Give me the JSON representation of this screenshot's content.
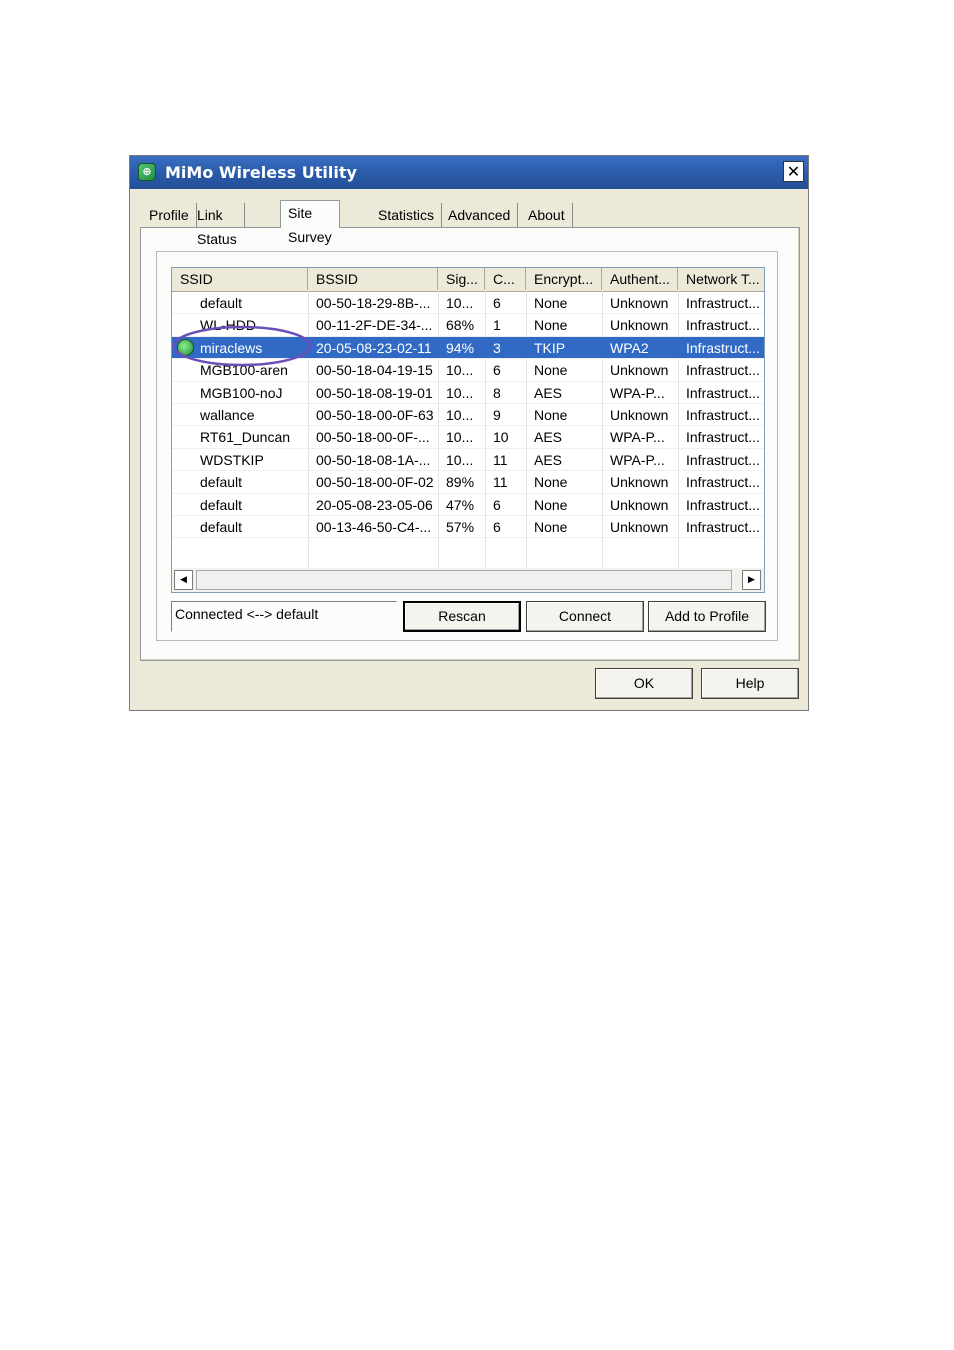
{
  "window": {
    "title": "MiMo Wireless Utility",
    "close_glyph": "✕"
  },
  "tabs": [
    {
      "label": "Profile"
    },
    {
      "label": "Link Status"
    },
    {
      "label": "Site Survey",
      "active": true
    },
    {
      "label": "Statistics"
    },
    {
      "label": "Advanced"
    },
    {
      "label": "About"
    }
  ],
  "table": {
    "columns": [
      "SSID",
      "BSSID",
      "Sig...",
      "C...",
      "Encrypt...",
      "Authent...",
      "Network T..."
    ],
    "rows": [
      {
        "ssid": "default",
        "bssid": "00-50-18-29-8B-...",
        "sig": "10...",
        "ch": "6",
        "enc": "None",
        "auth": "Unknown",
        "net": "Infrastruct..."
      },
      {
        "ssid": "WL-HDD",
        "bssid": "00-11-2F-DE-34-...",
        "sig": "68%",
        "ch": "1",
        "enc": "None",
        "auth": "Unknown",
        "net": "Infrastruct..."
      },
      {
        "ssid": "miraclews",
        "bssid": "20-05-08-23-02-11",
        "sig": "94%",
        "ch": "3",
        "enc": "TKIP",
        "auth": "WPA2",
        "net": "Infrastruct...",
        "selected": true
      },
      {
        "ssid": "MGB100-aren",
        "bssid": "00-50-18-04-19-15",
        "sig": "10...",
        "ch": "6",
        "enc": "None",
        "auth": "Unknown",
        "net": "Infrastruct..."
      },
      {
        "ssid": "MGB100-noJ",
        "bssid": "00-50-18-08-19-01",
        "sig": "10...",
        "ch": "8",
        "enc": "AES",
        "auth": "WPA-P...",
        "net": "Infrastruct..."
      },
      {
        "ssid": "wallance",
        "bssid": "00-50-18-00-0F-63",
        "sig": "10...",
        "ch": "9",
        "enc": "None",
        "auth": "Unknown",
        "net": "Infrastruct..."
      },
      {
        "ssid": "RT61_Duncan",
        "bssid": "00-50-18-00-0F-...",
        "sig": "10...",
        "ch": "10",
        "enc": "AES",
        "auth": "WPA-P...",
        "net": "Infrastruct..."
      },
      {
        "ssid": "WDSTKIP",
        "bssid": "00-50-18-08-1A-...",
        "sig": "10...",
        "ch": "11",
        "enc": "AES",
        "auth": "WPA-P...",
        "net": "Infrastruct..."
      },
      {
        "ssid": "default",
        "bssid": "00-50-18-00-0F-02",
        "sig": "89%",
        "ch": "11",
        "enc": "None",
        "auth": "Unknown",
        "net": "Infrastruct..."
      },
      {
        "ssid": "default",
        "bssid": "20-05-08-23-05-06",
        "sig": "47%",
        "ch": "6",
        "enc": "None",
        "auth": "Unknown",
        "net": "Infrastruct..."
      },
      {
        "ssid": "default",
        "bssid": "00-13-46-50-C4-...",
        "sig": "57%",
        "ch": "6",
        "enc": "None",
        "auth": "Unknown",
        "net": "Infrastruct..."
      }
    ]
  },
  "scrollbar": {
    "left_glyph": "◀",
    "right_glyph": "▶"
  },
  "status": {
    "text": "Connected <--> default"
  },
  "buttons": {
    "rescan": "Rescan",
    "connect": "Connect",
    "add_to_profile": "Add to Profile",
    "ok": "OK",
    "help": "Help"
  },
  "colors": {
    "title_bar": "#2a5aa8",
    "selection": "#316ac5",
    "annotation_ellipse": "#6a4fb8"
  }
}
